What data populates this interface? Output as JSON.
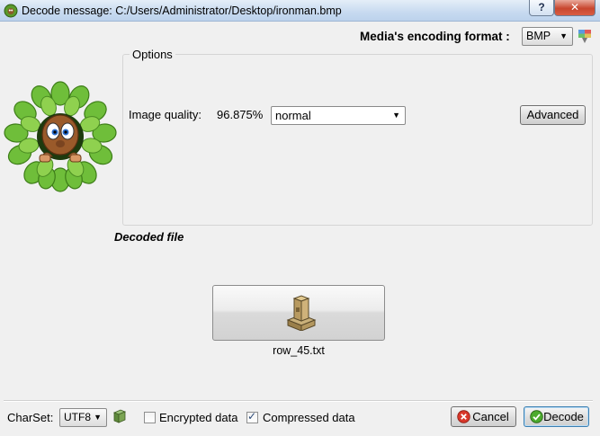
{
  "window": {
    "title": "Decode message: C:/Users/Administrator/Desktop/ironman.bmp",
    "help_label": "?",
    "close_label": "✕"
  },
  "encoding": {
    "label": "Media's encoding format :",
    "selected": "BMP"
  },
  "options": {
    "group_title": "Options",
    "quality_label": "Image quality:",
    "quality_value": "96.875%",
    "quality_selected": "normal",
    "advanced_label": "Advanced"
  },
  "decoded": {
    "section_label": "Decoded file",
    "file_name": "row_45.txt"
  },
  "footer": {
    "charset_label": "CharSet:",
    "charset_selected": "UTF8",
    "encrypted_label": "Encrypted data",
    "encrypted_checked": false,
    "compressed_label": "Compressed data",
    "compressed_checked": true,
    "cancel_label": "Cancel",
    "decode_label": "Decode"
  }
}
